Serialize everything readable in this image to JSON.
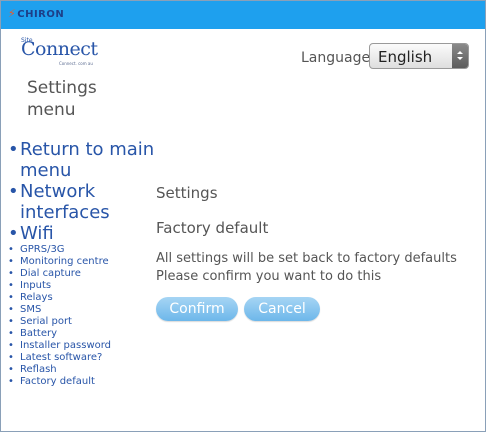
{
  "header": {
    "brand": "CHIRON"
  },
  "logo": {
    "site": "Site",
    "connect": "Connect",
    "tagline": "Connect. com au"
  },
  "language": {
    "label": "Language:",
    "selected": "English"
  },
  "sidebar": {
    "title": "Settings menu",
    "items": [
      {
        "label": "Return to main menu"
      },
      {
        "label": "Network interfaces"
      },
      {
        "label": "Wifi"
      },
      {
        "label": "GPRS/3G"
      },
      {
        "label": "Monitoring centre"
      },
      {
        "label": "Dial capture"
      },
      {
        "label": "Inputs"
      },
      {
        "label": "Relays"
      },
      {
        "label": "SMS"
      },
      {
        "label": "Serial port"
      },
      {
        "label": "Battery"
      },
      {
        "label": "Installer password"
      },
      {
        "label": "Latest software?"
      },
      {
        "label": "Reflash"
      },
      {
        "label": "Factory default"
      }
    ]
  },
  "main": {
    "heading": "Settings",
    "subheading": "Factory default",
    "message_line1": "All settings will be set back to factory defaults",
    "message_line2": "Please confirm you want to do this",
    "confirm_label": "Confirm",
    "cancel_label": "Cancel"
  },
  "colors": {
    "topbar": "#1ea0ee",
    "link": "#2855a8",
    "button": "#86c5ef"
  }
}
